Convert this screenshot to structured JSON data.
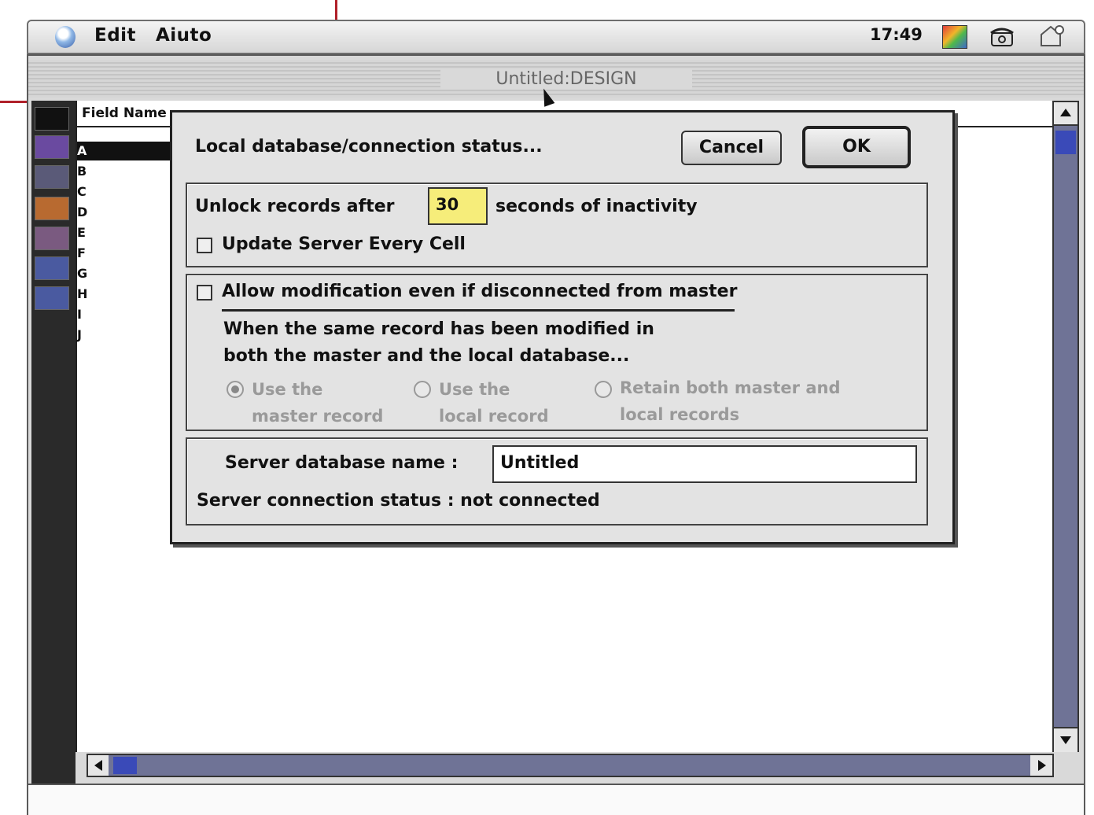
{
  "menubar": {
    "menus": [
      "Edit",
      "Aiuto"
    ],
    "clock": "17:49"
  },
  "window": {
    "title": "Untitled:DESIGN",
    "header": {
      "field_name_label": "Field Name"
    },
    "rows": [
      "A",
      "B",
      "C",
      "D",
      "E",
      "F",
      "G",
      "H",
      "I",
      "J"
    ]
  },
  "dialog": {
    "title": "Local database/connection status...",
    "cancel_label": "Cancel",
    "ok_label": "OK",
    "unlock": {
      "prefix": "Unlock records after",
      "value": "30",
      "suffix": "seconds of inactivity"
    },
    "update_server_label": "Update Server Every Cell",
    "update_server_checked": false,
    "allow_mod_label": "Allow modification even if disconnected from master",
    "allow_mod_checked": false,
    "conflict_text_1": "When the same record has been modified in",
    "conflict_text_2": "both the master and the local database...",
    "radio_options": [
      {
        "line1": "Use the",
        "line2": "master record",
        "selected": true
      },
      {
        "line1": "Use the",
        "line2": "local record",
        "selected": false
      },
      {
        "line1": "Retain both master and",
        "line2": "local records",
        "selected": false
      }
    ],
    "server_db_label": "Server database name :",
    "server_db_value": "Untitled",
    "server_status_label": "Server connection status : not connected"
  },
  "colors": {
    "dialog_bg": "#e3e3e3",
    "field_highlight": "#f6ed7a",
    "scrollbar": "#6f7396",
    "scroll_thumb": "#3a4ab8",
    "annotation_red": "#b0202a"
  },
  "icons": [
    "apple-icon",
    "color-palette-icon",
    "phone-icon",
    "network-icon"
  ]
}
